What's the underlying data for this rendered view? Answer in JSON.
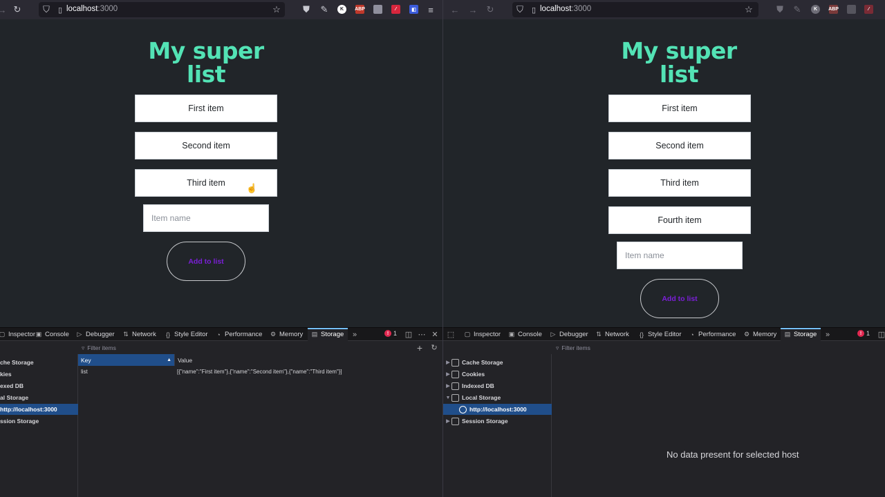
{
  "browser": {
    "url_host": "localhost",
    "url_port": ":3000"
  },
  "app": {
    "title_line1": "My super",
    "title_line2": "list",
    "input_placeholder": "Item name",
    "add_button_label": "Add to list"
  },
  "left_window": {
    "items": [
      "First item",
      "Second item",
      "Third item"
    ]
  },
  "right_window": {
    "items": [
      "First item",
      "Second item",
      "Third item",
      "Fourth item"
    ]
  },
  "devtools": {
    "tabs": [
      "Inspector",
      "Console",
      "Debugger",
      "Network",
      "Style Editor",
      "Performance",
      "Memory",
      "Storage"
    ],
    "active_tab": "Storage",
    "error_count": "1",
    "filter_placeholder": "Filter items",
    "tree": [
      "Cache Storage",
      "Cookies",
      "Indexed DB",
      "Local Storage",
      "http://localhost:3000",
      "Session Storage"
    ],
    "left_tree_visible": [
      "che Storage",
      "kies",
      "exed DB",
      "al Storage",
      "http://localhost:3000",
      "ssion Storage"
    ],
    "table_headers": {
      "key": "Key",
      "value": "Value"
    },
    "left_rows": [
      {
        "key": "list",
        "value": "[{\"name\":\"First item\"},{\"name\":\"Second item\"},{\"name\":\"Third item\"}]"
      }
    ],
    "right_message": "No data present for selected host"
  },
  "colors": {
    "title": "#53e3b5",
    "button_text": "#7b1fd8",
    "selection": "#204e8a"
  }
}
